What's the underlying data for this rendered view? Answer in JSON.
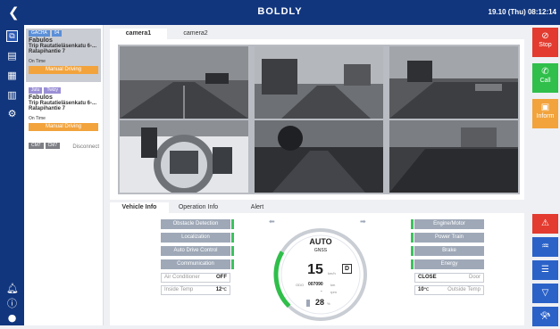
{
  "header": {
    "back_icon": "chevron-left-icon",
    "brand": "BOLDLY",
    "datetime": "19.10 (Thu) 08:12:14"
  },
  "rail": {
    "icons": [
      "camera-view-icon",
      "document-icon",
      "report-icon",
      "chart-icon",
      "settings-icon",
      "bell-icon",
      "info-icon",
      "user-icon"
    ]
  },
  "vehicles": [
    {
      "tags": [
        "GACHA",
        "04"
      ],
      "name": "Fabulos",
      "trip": "Trip Rautatieläsenkatu 6-...",
      "trip2": "Ratapihantie 7",
      "status": "On Time",
      "mode": "Manual Driving"
    },
    {
      "tags": [
        "Jutu",
        "Twizy"
      ],
      "name": "Fabulos",
      "trip": "Trip Rautatieläsenkatu 6-...",
      "trip2": "Ratapihantie 7",
      "status": "On Time",
      "mode": "Manual Driving"
    },
    {
      "tags": [
        "CM7",
        "CM7"
      ],
      "disconnect": "Disconnect"
    }
  ],
  "camera_tabs": [
    "camera1",
    "camera2"
  ],
  "bottom_tabs": [
    "Vehicle Info",
    "Operation Info",
    "Alert"
  ],
  "left_status": [
    "Obstacle Detection",
    "Localization",
    "Auto Drive Control",
    "Communication"
  ],
  "right_status": [
    "Engine/Motor",
    "Power Train",
    "Brake",
    "Energy"
  ],
  "air_conditioner": {
    "label": "Air Conditioner",
    "value": "OFF"
  },
  "inside_temp": {
    "label": "Inside Temp",
    "value": "12",
    "unit": "℃"
  },
  "door": {
    "label": "Door",
    "value": "CLOSE"
  },
  "outside_temp": {
    "label": "Outside Temp",
    "value": "10",
    "unit": "℃"
  },
  "gauge": {
    "mode": "AUTO",
    "source": "GNSS",
    "speed": "15",
    "speed_unit": "km/h",
    "gear": "D",
    "odo_label": "ODO",
    "odo": "007090",
    "odo_unit": "km",
    "rpm_value": "-",
    "rpm_unit": "rpm",
    "battery": "28",
    "battery_unit": "%",
    "battery_fraction": 0.28
  },
  "actions": [
    {
      "label": "Stop",
      "icon": "stop-icon"
    },
    {
      "label": "Call",
      "icon": "phone-icon"
    },
    {
      "label": "Inform",
      "icon": "announce-icon"
    }
  ],
  "quick_actions": [
    "hazard-icon",
    "front-defog-icon",
    "headlight-icon",
    "rear-defog-icon",
    "horn-icon"
  ],
  "colors": {
    "navy": "#11367e",
    "ok_green": "#3cc25d",
    "manual_orange": "#f2a33c",
    "stop_red": "#e33b2f",
    "call_green": "#2fbf4a",
    "action_blue": "#2b62c8"
  }
}
